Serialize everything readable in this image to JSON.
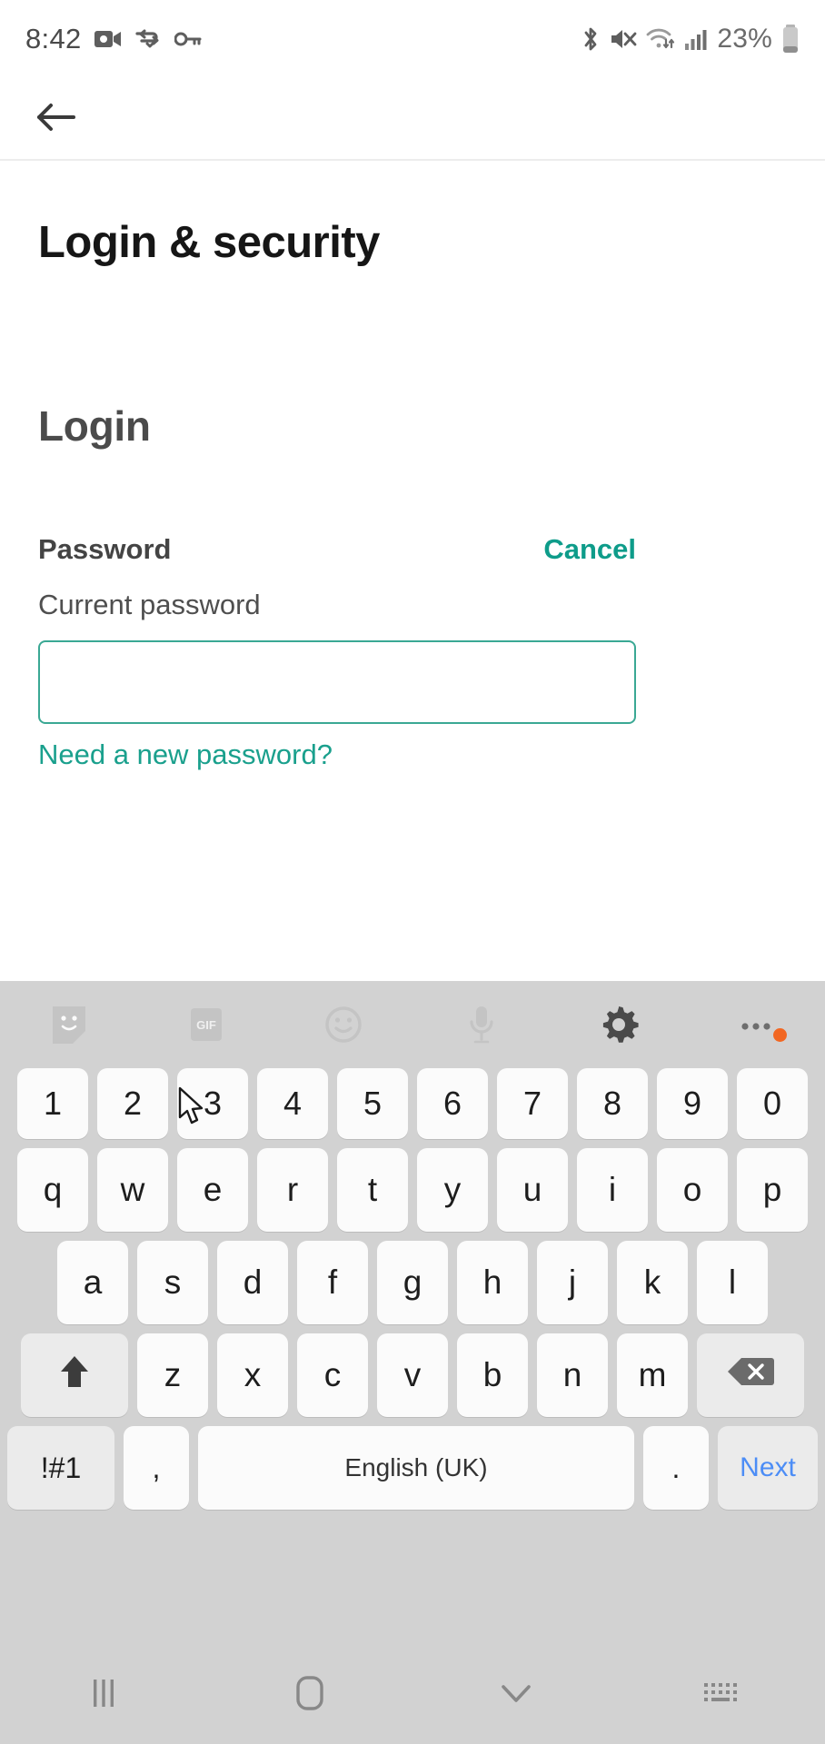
{
  "status_bar": {
    "time": "8:42",
    "battery_percent": "23%",
    "left_icons": [
      "video-camera-icon",
      "vpn-icon",
      "key-icon"
    ],
    "right_icons": [
      "bluetooth-icon",
      "mute-icon",
      "wifi-icon",
      "cellular-signal-icon",
      "battery-icon"
    ]
  },
  "app_bar": {
    "back_icon": "back-arrow-icon"
  },
  "content": {
    "page_title": "Login & security",
    "section_title": "Login",
    "field_label": "Password",
    "cancel_label": "Cancel",
    "field_sublabel": "Current password",
    "password_value": "",
    "password_placeholder": "",
    "help_link": "Need a new password?"
  },
  "colors": {
    "accent_teal": "#0E9C8A",
    "input_border": "#3aa894",
    "link_teal": "#1aa08d",
    "keyboard_bg": "#d2d2d2",
    "key_bg": "#fbfbfb",
    "key_grey_bg": "#ebebeb",
    "next_blue": "#4c8df6",
    "badge_orange": "#f26722"
  },
  "keyboard": {
    "toolbar": [
      {
        "name": "sticker-icon",
        "label": ""
      },
      {
        "name": "gif-icon",
        "label": "GIF"
      },
      {
        "name": "emoji-icon",
        "label": ""
      },
      {
        "name": "microphone-icon",
        "label": ""
      },
      {
        "name": "settings-gear-icon",
        "label": ""
      },
      {
        "name": "more-options-icon",
        "label": ""
      }
    ],
    "row_numbers": [
      "1",
      "2",
      "3",
      "4",
      "5",
      "6",
      "7",
      "8",
      "9",
      "0"
    ],
    "row_top": [
      "q",
      "w",
      "e",
      "r",
      "t",
      "y",
      "u",
      "i",
      "o",
      "p"
    ],
    "row_home": [
      "a",
      "s",
      "d",
      "f",
      "g",
      "h",
      "j",
      "k",
      "l"
    ],
    "row_bottom": [
      "z",
      "x",
      "c",
      "v",
      "b",
      "n",
      "m"
    ],
    "shift_icon": "shift-arrow-icon",
    "backspace_icon": "backspace-icon",
    "symbols_label": "!#1",
    "comma_label": ",",
    "space_label": "English (UK)",
    "period_label": ".",
    "next_label": "Next"
  },
  "nav_bar": {
    "items": [
      {
        "name": "recents-icon"
      },
      {
        "name": "home-icon"
      },
      {
        "name": "hide-keyboard-icon"
      },
      {
        "name": "keyboard-switch-icon"
      }
    ]
  }
}
